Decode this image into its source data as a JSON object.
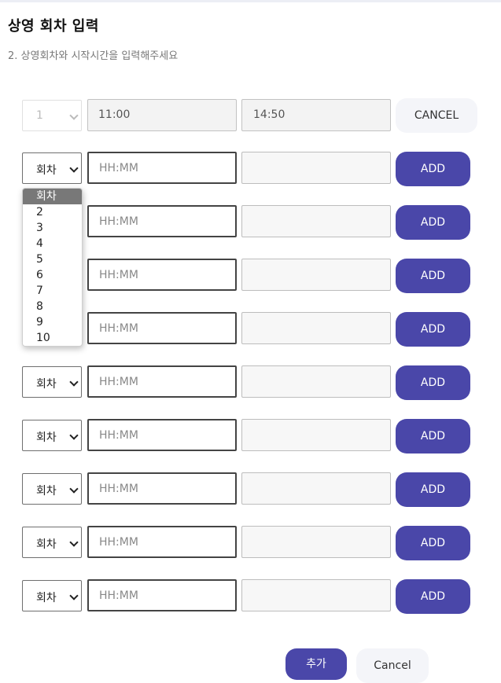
{
  "header": {
    "title": "상영 회차 입력",
    "subtitle": "2. 상영회차와 시작시간을 입력해주세요"
  },
  "filled_row": {
    "round": "1",
    "start_time": "11:00",
    "end_time": "14:50",
    "cancel_label": "CANCEL"
  },
  "rows": [
    {
      "round": "회차",
      "start_placeholder": "HH:MM",
      "end_value": "",
      "add_label": "ADD"
    },
    {
      "round": "회차",
      "start_placeholder": "HH:MM",
      "end_value": "",
      "add_label": "ADD"
    },
    {
      "round": "회차",
      "start_placeholder": "HH:MM",
      "end_value": "",
      "add_label": "ADD"
    },
    {
      "round": "회차",
      "start_placeholder": "HH:MM",
      "end_value": "",
      "add_label": "ADD"
    },
    {
      "round": "회차",
      "start_placeholder": "HH:MM",
      "end_value": "",
      "add_label": "ADD"
    },
    {
      "round": "회차",
      "start_placeholder": "HH:MM",
      "end_value": "",
      "add_label": "ADD"
    },
    {
      "round": "회차",
      "start_placeholder": "HH:MM",
      "end_value": "",
      "add_label": "ADD"
    },
    {
      "round": "회차",
      "start_placeholder": "HH:MM",
      "end_value": "",
      "add_label": "ADD"
    },
    {
      "round": "회차",
      "start_placeholder": "HH:MM",
      "end_value": "",
      "add_label": "ADD"
    }
  ],
  "dropdown": {
    "options": [
      "회차",
      "2",
      "3",
      "4",
      "5",
      "6",
      "7",
      "8",
      "9",
      "10"
    ],
    "highlighted": "회차"
  },
  "footer": {
    "submit_label": "추가",
    "cancel_label": "Cancel"
  },
  "colors": {
    "accent": "#4a47a9",
    "secondary_button": "#f4f5f9"
  }
}
